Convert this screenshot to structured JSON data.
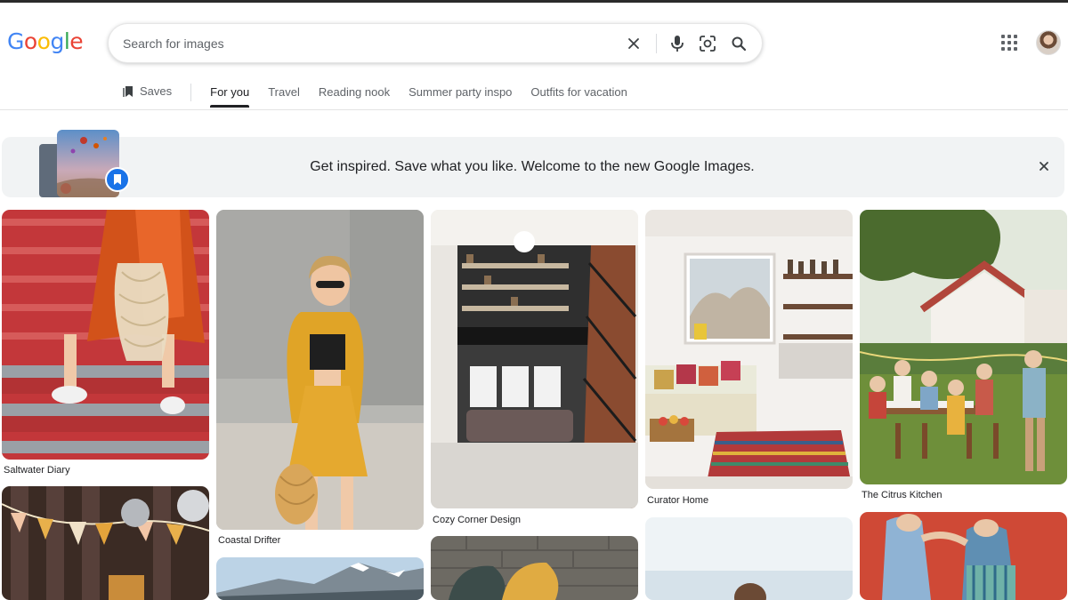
{
  "header": {
    "logo": [
      "G",
      "o",
      "o",
      "g",
      "l",
      "e"
    ],
    "logo_colors": [
      "#4285f4",
      "#ea4335",
      "#fbbc05",
      "#4285f4",
      "#34a853",
      "#ea4335"
    ],
    "search": {
      "placeholder": "Search for images",
      "value": ""
    },
    "icons": [
      "clear-icon",
      "microphone-icon",
      "google-lens-icon",
      "search-icon",
      "apps-grid-icon",
      "account-avatar"
    ]
  },
  "tabs": {
    "saves_label": "Saves",
    "items": [
      "For you",
      "Travel",
      "Reading nook",
      "Summer party inspo",
      "Outfits for vacation"
    ],
    "active": "For you"
  },
  "banner": {
    "text": "Get inspired. Save what you like. Welcome to the new Google Images."
  },
  "grid": {
    "captions": [
      "Saltwater Diary",
      "Coastal Drifter",
      "Cozy Corner Design",
      "Curator Home",
      "The Citrus Kitchen"
    ]
  },
  "colors": {
    "accent": "#202124",
    "muted": "#5f6368",
    "banner_bg": "#f1f3f4",
    "save_badge": "#1a73e8"
  }
}
